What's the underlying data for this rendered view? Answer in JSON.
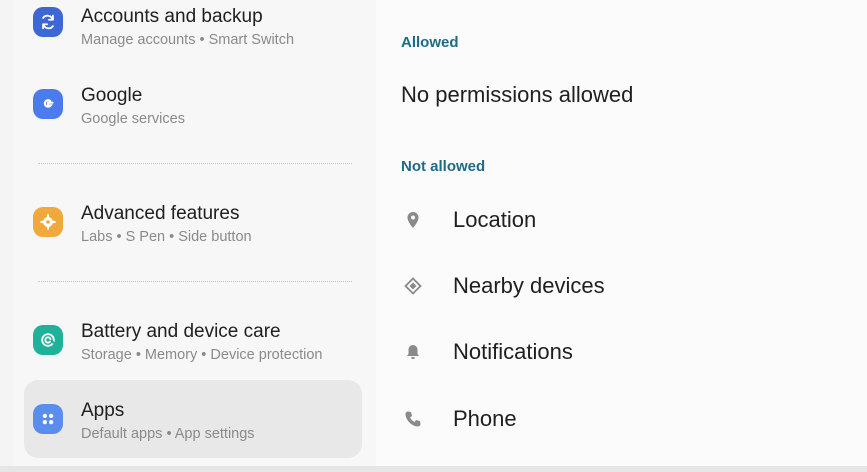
{
  "sidebar": {
    "items": [
      {
        "title": "Accounts and backup",
        "subtitle": "Manage accounts  •  Smart Switch",
        "icon": "sync-icon",
        "color": "#3e67d6"
      },
      {
        "title": "Google",
        "subtitle": "Google services",
        "icon": "google-g-icon",
        "color": "#4b7bec"
      },
      {
        "title": "Advanced features",
        "subtitle": "Labs  •  S Pen  •  Side button",
        "icon": "puzzle-gear-icon",
        "color": "#f2a93b"
      },
      {
        "title": "Battery and device care",
        "subtitle": "Storage  •  Memory  •  Device protection",
        "icon": "device-care-icon",
        "color": "#1fb19a"
      },
      {
        "title": "Apps",
        "subtitle": "Default apps  •  App settings",
        "icon": "apps-grid-icon",
        "color": "#5b8def"
      }
    ]
  },
  "main": {
    "allowed_header": "Allowed",
    "allowed_empty": "No permissions allowed",
    "not_allowed_header": "Not allowed",
    "not_allowed": [
      {
        "label": "Location",
        "icon": "location-pin-icon"
      },
      {
        "label": "Nearby devices",
        "icon": "nearby-devices-icon"
      },
      {
        "label": "Notifications",
        "icon": "bell-icon"
      },
      {
        "label": "Phone",
        "icon": "phone-icon"
      }
    ]
  }
}
